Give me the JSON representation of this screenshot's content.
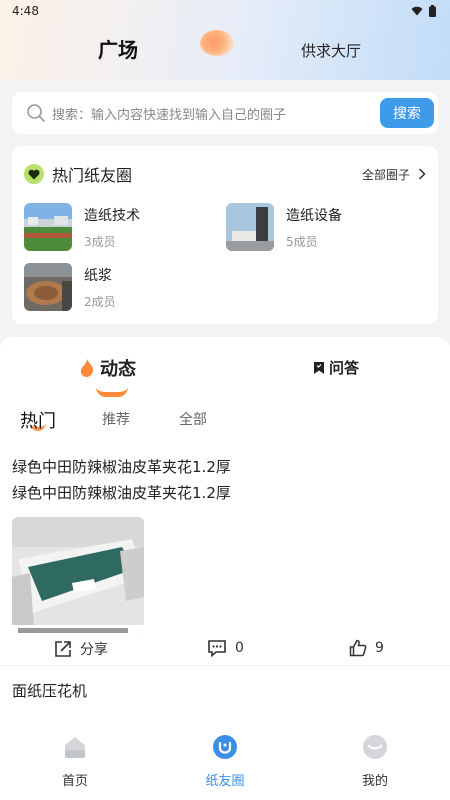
{
  "status_bar": {
    "time": "4:48"
  },
  "header": {
    "tab_square": "广场",
    "tab_supply": "供求大厅"
  },
  "search": {
    "placeholder": "搜索：输入内容快速找到输入自己的圈子",
    "button": "搜索"
  },
  "circles": {
    "title": "热门纸友圈",
    "all_link": "全部圈子",
    "items": [
      {
        "name": "造纸技术",
        "members": "3成员"
      },
      {
        "name": "造纸设备",
        "members": "5成员"
      },
      {
        "name": "纸浆",
        "members": "2成员"
      }
    ]
  },
  "feed": {
    "tabs": {
      "dynamic": "动态",
      "qa": "问答"
    },
    "sub_tabs": [
      "热门",
      "推荐",
      "全部"
    ],
    "post1": {
      "line1": "绿色中田防辣椒油皮革夹花1.2厚",
      "line2": "绿色中田防辣椒油皮革夹花1.2厚",
      "share_label": "分享",
      "comment_count": "0",
      "like_count": "9"
    },
    "post2": {
      "title": "面纸压花机"
    }
  },
  "bottom_nav": {
    "home": "首页",
    "circle": "纸友圈",
    "mine": "我的"
  },
  "colors": {
    "accent": "#3d9be9",
    "orange": "#ff8a3d",
    "badge_green": "#b6e26c"
  }
}
